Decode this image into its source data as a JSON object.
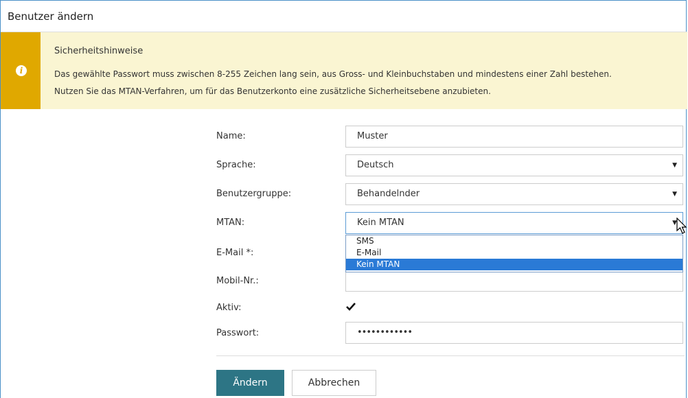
{
  "dialog": {
    "title": "Benutzer ändern"
  },
  "alert": {
    "title": "Sicherheitshinweise",
    "line1": "Das gewählte Passwort muss zwischen 8-255 Zeichen lang sein, aus Gross- und Kleinbuchstaben und mindestens einer Zahl bestehen.",
    "line2": "Nutzen Sie das MTAN-Verfahren, um für das Benutzerkonto eine zusätzliche Sicherheitsebene anzubieten.",
    "icon": "info-icon",
    "color": "#e0a800"
  },
  "form": {
    "name": {
      "label": "Name:",
      "value": "Muster"
    },
    "language": {
      "label": "Sprache:",
      "value": "Deutsch"
    },
    "group": {
      "label": "Benutzergruppe:",
      "value": "Behandelnder"
    },
    "mtan": {
      "label": "MTAN:",
      "value": "Kein MTAN",
      "options": [
        "SMS",
        "E-Mail",
        "Kein MTAN"
      ]
    },
    "email": {
      "label": "E-Mail *:",
      "value": ""
    },
    "mobile": {
      "label": "Mobil-Nr.:",
      "value": ""
    },
    "active": {
      "label": "Aktiv:",
      "checked": true
    },
    "password": {
      "label": "Passwort:",
      "value": "••••••••••••"
    }
  },
  "actions": {
    "submit_label": "Ändern",
    "cancel_label": "Abbrechen",
    "primary_color": "#2d7585"
  }
}
